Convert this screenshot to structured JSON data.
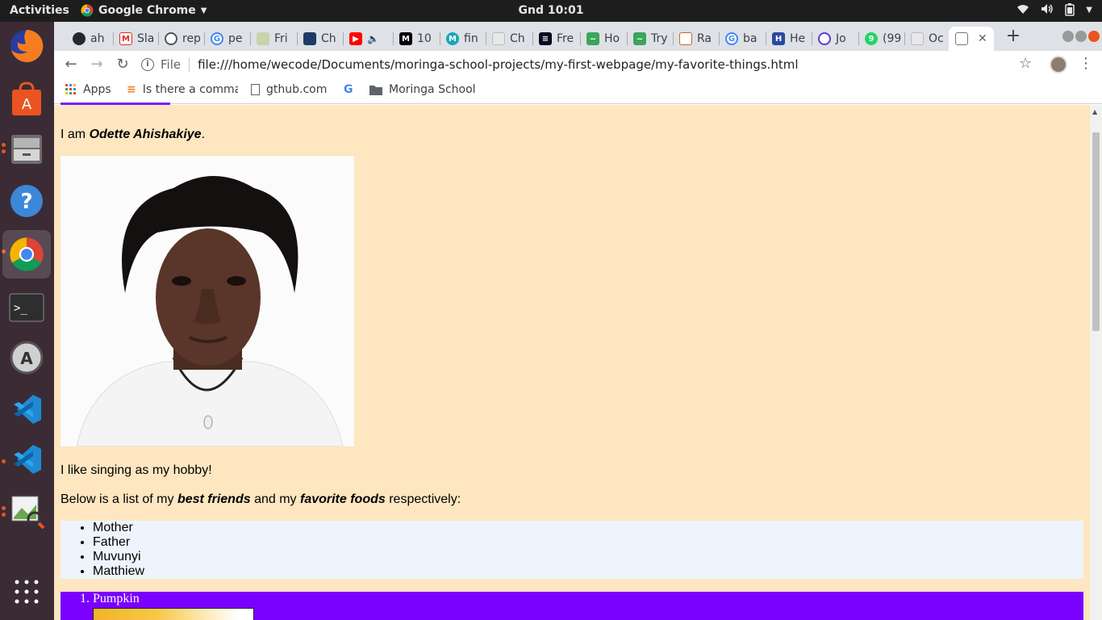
{
  "topbar": {
    "activities": "Activities",
    "app_name": "Google Chrome",
    "clock": "Gnd 10:01"
  },
  "dock": {
    "items": [
      "firefox",
      "software-center",
      "files",
      "help",
      "chrome",
      "terminal",
      "software-updater",
      "vscode",
      "vscode",
      "image-viewer",
      "show-apps"
    ]
  },
  "tabs": [
    {
      "title": "ah",
      "icon": "github-icon"
    },
    {
      "title": "Sla",
      "icon": "gmail-icon"
    },
    {
      "title": "rep",
      "icon": "replit-icon"
    },
    {
      "title": "pe",
      "icon": "google-icon"
    },
    {
      "title": "Fri",
      "icon": "frienship-icon"
    },
    {
      "title": "Ch",
      "icon": "page-icon"
    },
    {
      "title": "",
      "icon": "youtube-icon"
    },
    {
      "title": "10",
      "icon": "medium-icon"
    },
    {
      "title": "fin",
      "icon": "moringa-icon"
    },
    {
      "title": "Ch",
      "icon": "page-icon"
    },
    {
      "title": "Fre",
      "icon": "freecodecamp-icon"
    },
    {
      "title": "Ho",
      "icon": "sheet-icon"
    },
    {
      "title": "Try",
      "icon": "sheet-icon"
    },
    {
      "title": "Ra",
      "icon": "box-icon"
    },
    {
      "title": "ba",
      "icon": "google-icon"
    },
    {
      "title": "He",
      "icon": "h-icon"
    },
    {
      "title": "Jo",
      "icon": "circle-icon"
    },
    {
      "title": "(99",
      "icon": "whatsapp-icon"
    },
    {
      "title": "Oc",
      "icon": "page-icon"
    },
    {
      "title": "",
      "icon": "page-icon",
      "active": true
    }
  ],
  "omnibox": {
    "scheme": "File",
    "url": "file:///home/wecode/Documents/moringa-school-projects/my-first-webpage/my-favorite-things.html"
  },
  "bookmarks": [
    {
      "label": "Apps",
      "icon": "apps-grid-icon"
    },
    {
      "label": "Is there a comma",
      "icon": "stackoverflow-icon"
    },
    {
      "label": "gthub.com",
      "icon": "page-icon"
    },
    {
      "label": "",
      "icon": "google-icon"
    },
    {
      "label": "Moringa School",
      "icon": "folder-icon"
    }
  ],
  "page": {
    "intro_prefix": "I am ",
    "name": "Odette Ahishakiye",
    "intro_suffix": ".",
    "hobby": "I like singing as my hobby!",
    "below_prefix": "Below is a list of my ",
    "best_friends": "best friends",
    "below_mid": " and my ",
    "favorite_foods": "favorite foods",
    "below_suffix": " respectively:",
    "friends": [
      "Mother",
      "Father",
      "Muvunyi",
      "Matthiew"
    ],
    "foods": [
      "Pumpkin"
    ]
  },
  "colors": {
    "page_bg": "#fde6c0",
    "friends_bg": "#eef4fb",
    "foods_bg": "#7a00ff"
  }
}
